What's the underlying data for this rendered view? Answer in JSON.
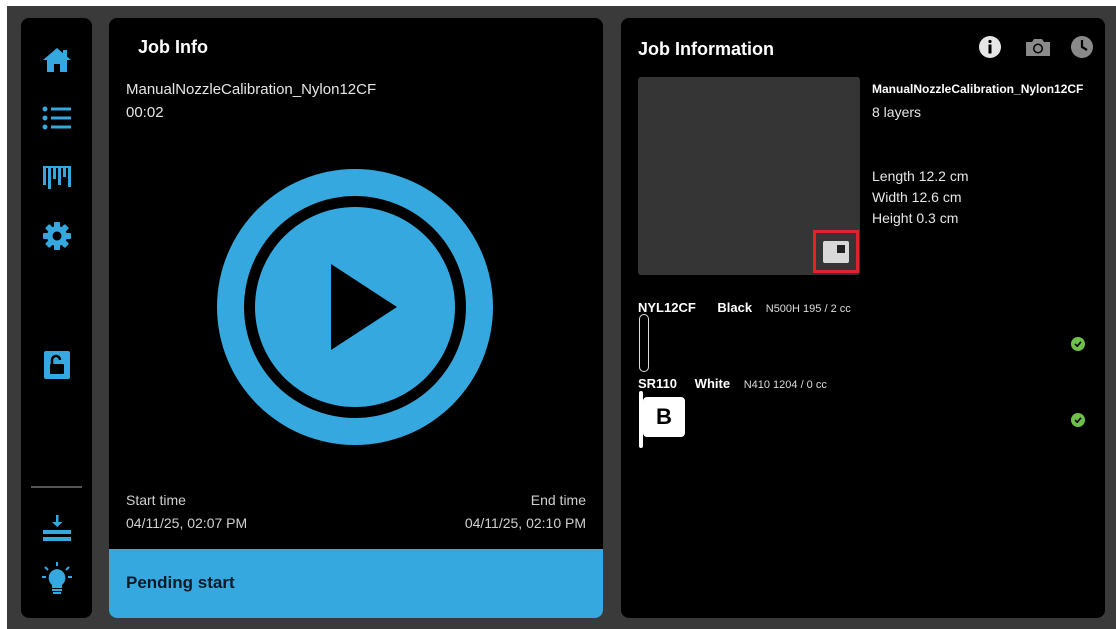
{
  "sidebar": {
    "items": [
      {
        "icon": "home-icon"
      },
      {
        "icon": "list-icon"
      },
      {
        "icon": "nozzle-icon"
      },
      {
        "icon": "gear-icon"
      },
      {
        "icon": "unlock-icon"
      },
      {
        "icon": "unload-icon"
      },
      {
        "icon": "light-bulb-icon"
      }
    ],
    "accent": "#35a8df"
  },
  "job_info": {
    "title": "Job Info",
    "job_name": "ManualNozzleCalibration_Nylon12CF",
    "elapsed": "00:02",
    "start_label": "Start time",
    "start_value": "04/11/25, 02:07 PM",
    "end_label": "End time",
    "end_value": "04/11/25, 02:10 PM",
    "status": "Pending start"
  },
  "job_information": {
    "title": "Job Information",
    "header_icons": [
      "info-icon",
      "camera-icon",
      "history-clock-icon"
    ],
    "name": "ManualNozzleCalibration_Nylon12CF",
    "layers": "8 layers",
    "length": "Length 12.2 cm",
    "width": "Width 12.6 cm",
    "height": "Height 0.3 cm",
    "materials": [
      {
        "material": "NYL12CF",
        "color": "Black",
        "detail": "N500H 195 / 2 cc",
        "status": "ok"
      },
      {
        "material": "SR110",
        "color": "White",
        "detail": "N410 1204 / 0 cc",
        "badge": "B",
        "status": "ok"
      }
    ]
  }
}
